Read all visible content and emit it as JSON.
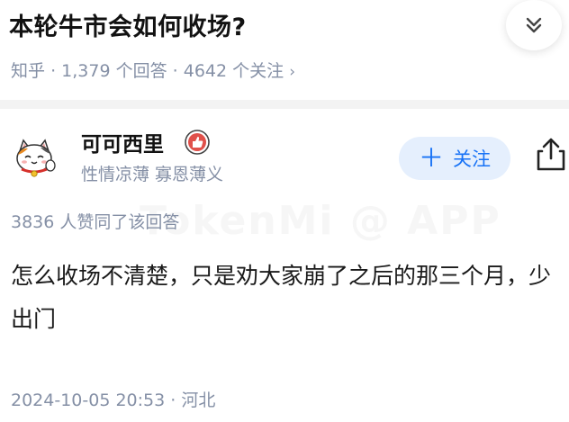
{
  "question": {
    "title": "本轮牛市会如何收场?",
    "meta": {
      "source": "知乎",
      "answer_count": "1,379 个回答",
      "follower_count": "4642 个关注",
      "separator": "·",
      "chevron": "›"
    }
  },
  "answer": {
    "author": {
      "name": "可可西里",
      "bio": "性情凉薄 寡恩薄义"
    },
    "follow_label": "关注",
    "likes_text": "3836 人赞同了该回答",
    "content": "怎么收场不清楚，只是劝大家崩了之后的那三个月，少出门",
    "timestamp": "2024-10-05 20:53",
    "location": "河北"
  },
  "watermark": "TokenMi @ APP",
  "colors": {
    "accent": "#1772f6",
    "follow_bg": "#e5effd",
    "meta_text": "#8590a6",
    "badge_red": "#e0504a"
  },
  "icons": [
    "double-chevron-down-icon",
    "plus-icon",
    "share-icon",
    "verified-badge-icon",
    "lucky-cat-avatar"
  ]
}
